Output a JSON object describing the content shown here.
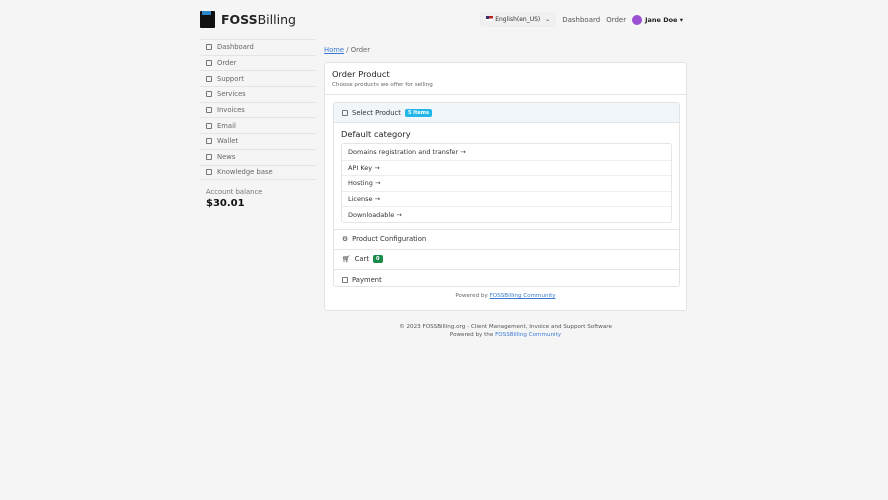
{
  "brand": {
    "bold": "FOSS",
    "rest": "Billing"
  },
  "header": {
    "language": "English(en_US)",
    "nav": [
      "Dashboard",
      "Order"
    ],
    "user": "Jane Doe"
  },
  "sidebar": {
    "items": [
      {
        "label": "Dashboard",
        "icon": "dashboard-icon"
      },
      {
        "label": "Order",
        "icon": "cart-icon"
      },
      {
        "label": "Support",
        "icon": "support-icon"
      },
      {
        "label": "Services",
        "icon": "services-icon"
      },
      {
        "label": "Invoices",
        "icon": "invoice-icon"
      },
      {
        "label": "Email",
        "icon": "email-icon"
      },
      {
        "label": "Wallet",
        "icon": "wallet-icon"
      },
      {
        "label": "News",
        "icon": "news-icon"
      },
      {
        "label": "Knowledge base",
        "icon": "book-icon"
      }
    ],
    "balance_label": "Account balance",
    "balance": "$30.01"
  },
  "breadcrumb": {
    "home": "Home",
    "sep": "/",
    "current": "Order"
  },
  "card": {
    "title": "Order Product",
    "subtitle": "Choose products we offer for selling",
    "select_product": "Select Product",
    "items_badge": "5 Items",
    "category": "Default category",
    "products": [
      "Domains registration and transfer",
      "API Key",
      "Hosting",
      "License",
      "Downloadable"
    ],
    "arrow": "→",
    "product_config": "Product Configuration",
    "cart": "Cart",
    "cart_count": "0",
    "payment": "Payment",
    "powered_prefix": "Powered by",
    "powered_link": "FOSSBilling Community"
  },
  "footer": {
    "line1": "© 2023 FOSSBilling.org - Client Management, Invoice and Support Software",
    "line2_prefix": "Powered by the",
    "line2_link": "FOSSBilling Community"
  }
}
